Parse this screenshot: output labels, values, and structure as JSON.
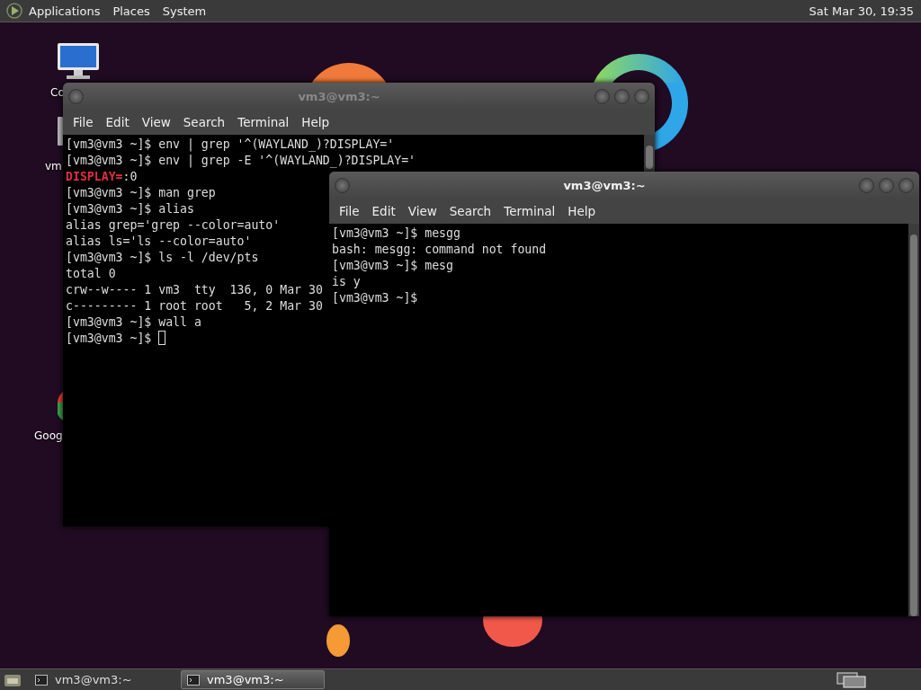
{
  "top_panel": {
    "menus": [
      "Applications",
      "Places",
      "System"
    ],
    "clock": "Sat Mar 30, 19:35"
  },
  "desktop_icons": [
    {
      "kind": "computer",
      "label": "Co"
    },
    {
      "kind": "folder",
      "label": "vm"
    },
    {
      "kind": "browser",
      "label": "Goog"
    }
  ],
  "windows": [
    {
      "title": "vm3@vm3:~",
      "active": false,
      "cursor": true,
      "menus": [
        "File",
        "Edit",
        "View",
        "Search",
        "Terminal",
        "Help"
      ],
      "lines": [
        {
          "kind": "plain",
          "text": "[vm3@vm3 ~]$ env | grep '^(WAYLAND_)?DISPLAY='"
        },
        {
          "kind": "plain",
          "text": "[vm3@vm3 ~]$ env | grep -E '^(WAYLAND_)?DISPLAY='"
        },
        {
          "kind": "match",
          "match": "DISPLAY=",
          "text": ":0"
        },
        {
          "kind": "plain",
          "text": "[vm3@vm3 ~]$ man grep"
        },
        {
          "kind": "plain",
          "text": "[vm3@vm3 ~]$ alias"
        },
        {
          "kind": "plain",
          "text": "alias grep='grep --color=auto'"
        },
        {
          "kind": "plain",
          "text": "alias ls='ls --color=auto'"
        },
        {
          "kind": "plain",
          "text": "[vm3@vm3 ~]$ ls -l /dev/pts"
        },
        {
          "kind": "plain",
          "text": "total 0"
        },
        {
          "kind": "plain",
          "text": "crw--w---- 1 vm3  tty  136, 0 Mar 30"
        },
        {
          "kind": "plain",
          "text": "c--------- 1 root root   5, 2 Mar 30"
        },
        {
          "kind": "plain",
          "text": "[vm3@vm3 ~]$ wall a"
        },
        {
          "kind": "plain",
          "text": "[vm3@vm3 ~]$"
        }
      ]
    },
    {
      "title": "vm3@vm3:~",
      "active": true,
      "cursor": false,
      "menus": [
        "File",
        "Edit",
        "View",
        "Search",
        "Terminal",
        "Help"
      ],
      "lines": [
        {
          "kind": "plain",
          "text": "[vm3@vm3 ~]$ mesgg"
        },
        {
          "kind": "plain",
          "text": "bash: mesgg: command not found"
        },
        {
          "kind": "plain",
          "text": "[vm3@vm3 ~]$ mesg"
        },
        {
          "kind": "plain",
          "text": "is y"
        },
        {
          "kind": "plain",
          "text": "[vm3@vm3 ~]$"
        }
      ]
    }
  ],
  "taskbar": {
    "tasks": [
      {
        "label": "vm3@vm3:~",
        "selected": false
      },
      {
        "label": "vm3@vm3:~",
        "selected": true
      }
    ]
  }
}
